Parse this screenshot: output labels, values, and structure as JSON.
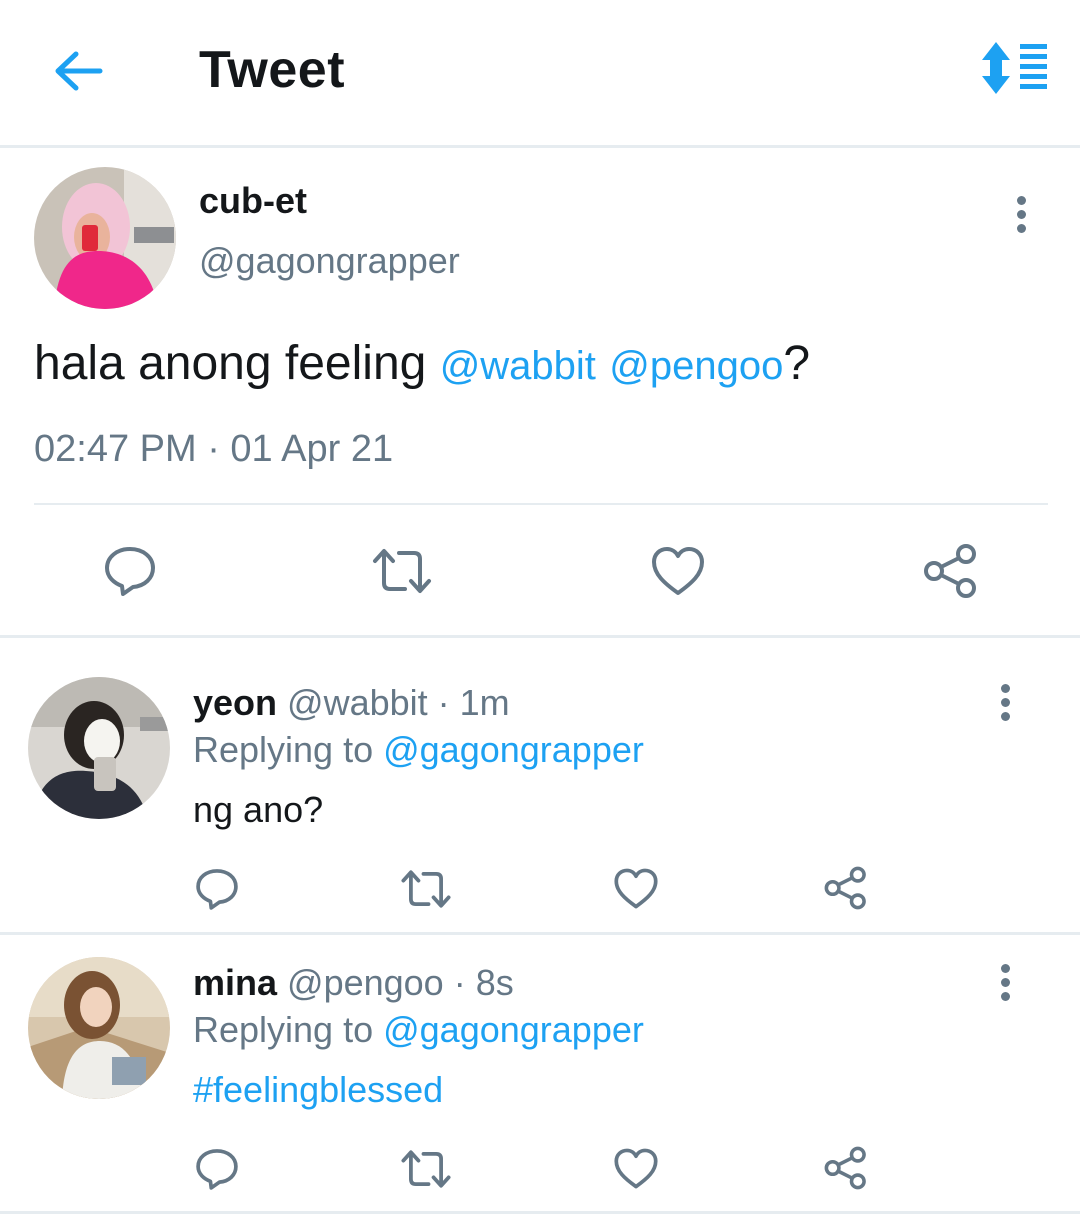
{
  "header": {
    "title": "Tweet",
    "back_icon": "arrow-left-icon",
    "sort_icon": "sort-replies-icon",
    "accent": "#1da1f2"
  },
  "main_tweet": {
    "display_name": "cub-et",
    "handle": "@gagongrapper",
    "text_prefix": "hala anong feeling ",
    "mention_1": "@wabbit",
    "mention_sep": " ",
    "mention_2": "@pengoo",
    "text_suffix": "?",
    "timestamp": "02:47 PM · 01 Apr 21",
    "actions": [
      "reply-icon",
      "retweet-icon",
      "like-icon",
      "share-icon"
    ]
  },
  "replies": [
    {
      "display_name": "yeon",
      "handle_time": " @wabbit · 1m",
      "replying_label": "Replying to ",
      "replying_to": "@gagongrapper",
      "text": "ng ano?",
      "text_is_link": false
    },
    {
      "display_name": "mina",
      "handle_time": " @pengoo · 8s",
      "replying_label": "Replying to ",
      "replying_to": "@gagongrapper",
      "text": "#feelingblessed",
      "text_is_link": true
    }
  ],
  "colors": {
    "text_primary": "#14171a",
    "text_secondary": "#657786",
    "link": "#1da1f2",
    "divider": "#e6ecf0"
  }
}
